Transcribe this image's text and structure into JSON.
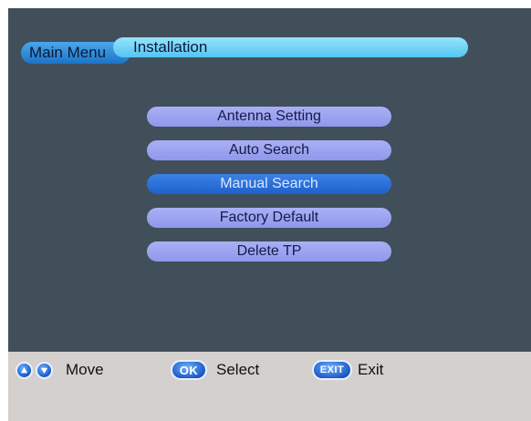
{
  "header": {
    "root_label": "Main Menu",
    "title": "Installation"
  },
  "menu": {
    "items": [
      {
        "label": "Antenna Setting"
      },
      {
        "label": "Auto Search"
      },
      {
        "label": "Manual Search",
        "selected": true
      },
      {
        "label": "Factory Default"
      },
      {
        "label": "Delete TP"
      }
    ]
  },
  "hints": {
    "move": {
      "label": "Move",
      "icons": [
        "up-arrow-icon",
        "down-arrow-icon"
      ]
    },
    "select": {
      "key": "OK",
      "label": "Select"
    },
    "exit": {
      "key": "EXIT",
      "label": "Exit"
    }
  },
  "colors": {
    "screen_bg": "#404f5a",
    "menu_item": "#9ea5f0",
    "menu_item_selected": "#2a6fdc",
    "header_title": "#7dd6f8",
    "hint_bar": "#d3d0cd",
    "button_blue": "#1f63d0"
  }
}
